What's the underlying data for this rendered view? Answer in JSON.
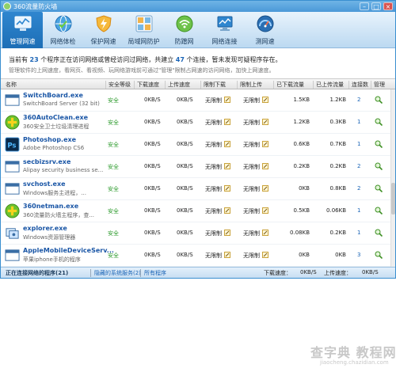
{
  "window": {
    "title": "360流量防火墙",
    "minimize": "–",
    "maximize": "□",
    "close": "×"
  },
  "toolbar": {
    "items": [
      {
        "label": "管理网速",
        "icon": "speed-monitor-icon",
        "active": true
      },
      {
        "label": "网络体检",
        "icon": "globe-checkup-icon",
        "active": false
      },
      {
        "label": "保护网速",
        "icon": "lightning-shield-icon",
        "active": false
      },
      {
        "label": "局域网防护",
        "icon": "lan-grid-icon",
        "active": false
      },
      {
        "label": "防蹭网",
        "icon": "wifi-protect-icon",
        "active": false
      },
      {
        "label": "网络连接",
        "icon": "network-connection-icon",
        "active": false
      },
      {
        "label": "测网速",
        "icon": "speedometer-icon",
        "active": false
      }
    ]
  },
  "info": {
    "prefix": "当前有",
    "program_count": "23",
    "mid": "个程序正在访问网络或曾经访问过网络，共建立",
    "connection_count": "47",
    "suffix": "个连接，暂未发现可疑程序存在。",
    "hint": "管理软件的上网速度，看网页、看视频、玩网络游戏前可通过\"管理\"限制占网速的访问网络，加快上网速度。"
  },
  "table": {
    "headers": {
      "name": "名称",
      "security": "安全等级",
      "down_speed": "下载速度",
      "up_speed": "上传速度",
      "limit_down": "限制下载",
      "limit_up": "限制上传",
      "downloaded": "已下载流量",
      "uploaded": "已上传流量",
      "connections": "连接数",
      "manage": "管理"
    },
    "rows": [
      {
        "name": "SwitchBoard.exe",
        "desc": "SwitchBoard Server (32 bit)",
        "icon": "window-app-icon",
        "security": "安全",
        "down": "0KB/S",
        "up": "0KB/S",
        "limit_down": "无限制",
        "limit_up": "无限制",
        "downloaded": "1.5KB",
        "uploaded": "1.2KB",
        "connections": "2"
      },
      {
        "name": "360AutoClean.exe",
        "desc": "360安全卫士垃圾清理进程",
        "icon": "360-plus-icon",
        "security": "安全",
        "down": "0KB/S",
        "up": "0KB/S",
        "limit_down": "无限制",
        "limit_up": "无限制",
        "downloaded": "1.2KB",
        "uploaded": "0.3KB",
        "connections": "1"
      },
      {
        "name": "Photoshop.exe",
        "desc": "Adobe Photoshop CS6",
        "icon": "photoshop-icon",
        "security": "安全",
        "down": "0KB/S",
        "up": "0KB/S",
        "limit_down": "无限制",
        "limit_up": "无限制",
        "downloaded": "0.6KB",
        "uploaded": "0.7KB",
        "connections": "1"
      },
      {
        "name": "secbizsrv.exe",
        "desc": "Alipay security business se...",
        "icon": "window-app-icon",
        "security": "安全",
        "down": "0KB/S",
        "up": "0KB/S",
        "limit_down": "无限制",
        "limit_up": "无限制",
        "downloaded": "0.2KB",
        "uploaded": "0.2KB",
        "connections": "2"
      },
      {
        "name": "svchost.exe",
        "desc": "Windows服务主进程，...",
        "icon": "window-app-icon",
        "security": "安全",
        "down": "0KB/S",
        "up": "0KB/S",
        "limit_down": "无限制",
        "limit_up": "无限制",
        "downloaded": "0KB",
        "uploaded": "0.8KB",
        "connections": "2"
      },
      {
        "name": "360netman.exe",
        "desc": "360流量防火墙主程序，查...",
        "icon": "360-plus-icon",
        "security": "安全",
        "down": "0KB/S",
        "up": "0KB/S",
        "limit_down": "无限制",
        "limit_up": "无限制",
        "downloaded": "0.5KB",
        "uploaded": "0.06KB",
        "connections": "1"
      },
      {
        "name": "explorer.exe",
        "desc": "Windows资源管理器",
        "icon": "explorer-icon",
        "security": "安全",
        "down": "0KB/S",
        "up": "0KB/S",
        "limit_down": "无限制",
        "limit_up": "无限制",
        "downloaded": "0.08KB",
        "uploaded": "0.2KB",
        "connections": "1"
      },
      {
        "name": "AppleMobileDeviceServ...",
        "desc": "苹果iphone手机的程序",
        "icon": "window-app-icon",
        "security": "安全",
        "down": "0KB/S",
        "up": "0KB/S",
        "limit_down": "无限制",
        "limit_up": "无限制",
        "downloaded": "0KB",
        "uploaded": "0KB",
        "connections": "3"
      }
    ]
  },
  "statusbar": {
    "tab_active": "正在连接网络的程序(21)",
    "tab_hidden": "隐藏的系统服务(2)",
    "tab_all": "所有程序",
    "down_label": "下载速度：",
    "down_value": "0KB/S",
    "up_label": "上传速度：",
    "up_value": "0KB/S"
  },
  "watermark": {
    "text": "查字典 教程网",
    "url": "jiaocheng.chazidian.com"
  },
  "colors": {
    "accent": "#1d6eb6",
    "safe": "#2b9a2b",
    "link": "#1a64b6"
  }
}
